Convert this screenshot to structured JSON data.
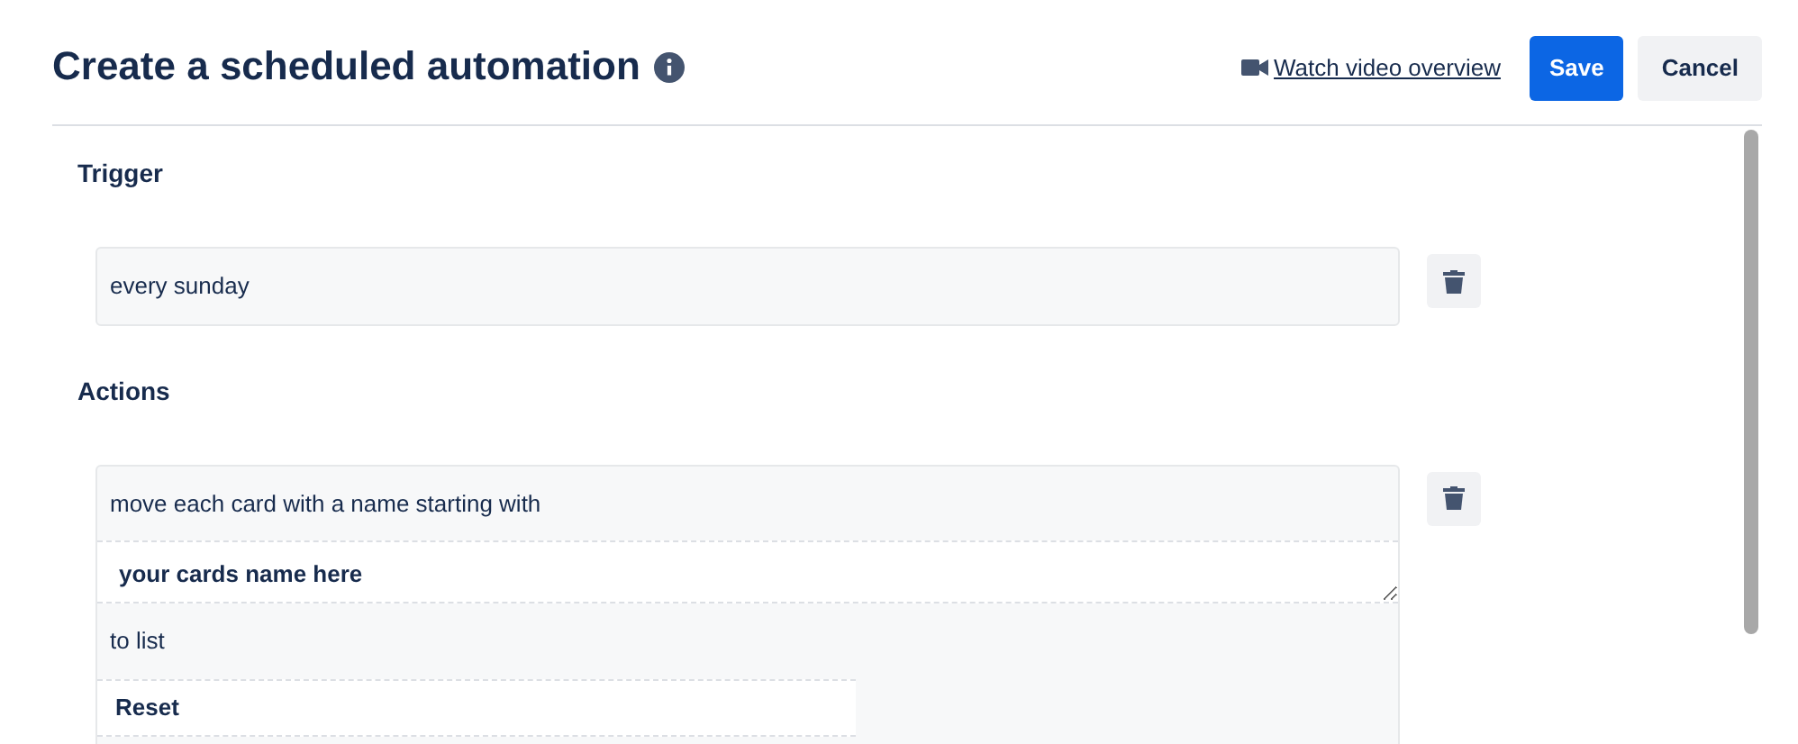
{
  "header": {
    "title": "Create a scheduled automation",
    "video_link": "Watch video overview",
    "buttons": [
      {
        "label": "Save",
        "kind": "primary"
      },
      {
        "label": "Cancel",
        "kind": "secondary"
      }
    ]
  },
  "sections": [
    {
      "heading": "Trigger",
      "blocks": [
        {
          "parts": [
            {
              "kind": "text",
              "text": "every sunday"
            }
          ]
        }
      ]
    },
    {
      "heading": "Actions",
      "blocks": [
        {
          "parts": [
            {
              "kind": "text",
              "text": "move each card with a name starting with"
            },
            {
              "kind": "textarea",
              "value": "your cards name here"
            },
            {
              "kind": "text",
              "text": "to list"
            },
            {
              "kind": "input",
              "value": "Reset"
            }
          ]
        }
      ]
    }
  ]
}
